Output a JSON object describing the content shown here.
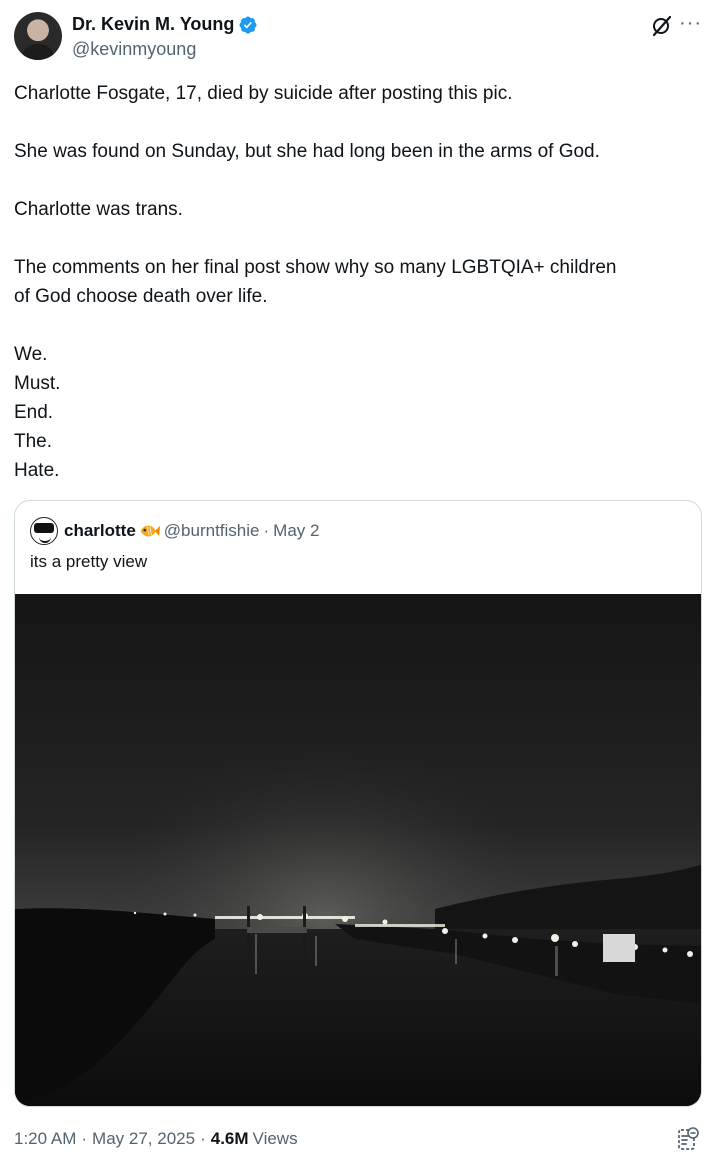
{
  "author": {
    "display_name": "Dr. Kevin M. Young",
    "handle": "@kevinmyoung",
    "verified": true,
    "verified_color": "#1d9bf0"
  },
  "icons": {
    "grok": "grok-icon",
    "more": "more-options-icon",
    "analytics": "analytics-icon"
  },
  "tweet": {
    "paragraphs": [
      [
        "Charlotte Fosgate, 17, died by suicide after posting this pic."
      ],
      [
        "She was found on Sunday, but she had long been in the arms of God."
      ],
      [
        "Charlotte was trans."
      ],
      [
        "The comments on her final post show why so many LGBTQIA+ children",
        "of God choose death over life."
      ],
      [
        "We.",
        "Must.",
        "End.",
        "The.",
        "Hate."
      ]
    ]
  },
  "quote": {
    "display_name": "charlotte",
    "emoji": "fish-icon",
    "handle": "@burntfishie",
    "separator": "·",
    "date": "May 2",
    "text": "its a pretty view"
  },
  "footer": {
    "time": "1:20 AM",
    "separator": "·",
    "date": "May 27, 2025",
    "views_count": "4.6M",
    "views_label": "Views"
  }
}
